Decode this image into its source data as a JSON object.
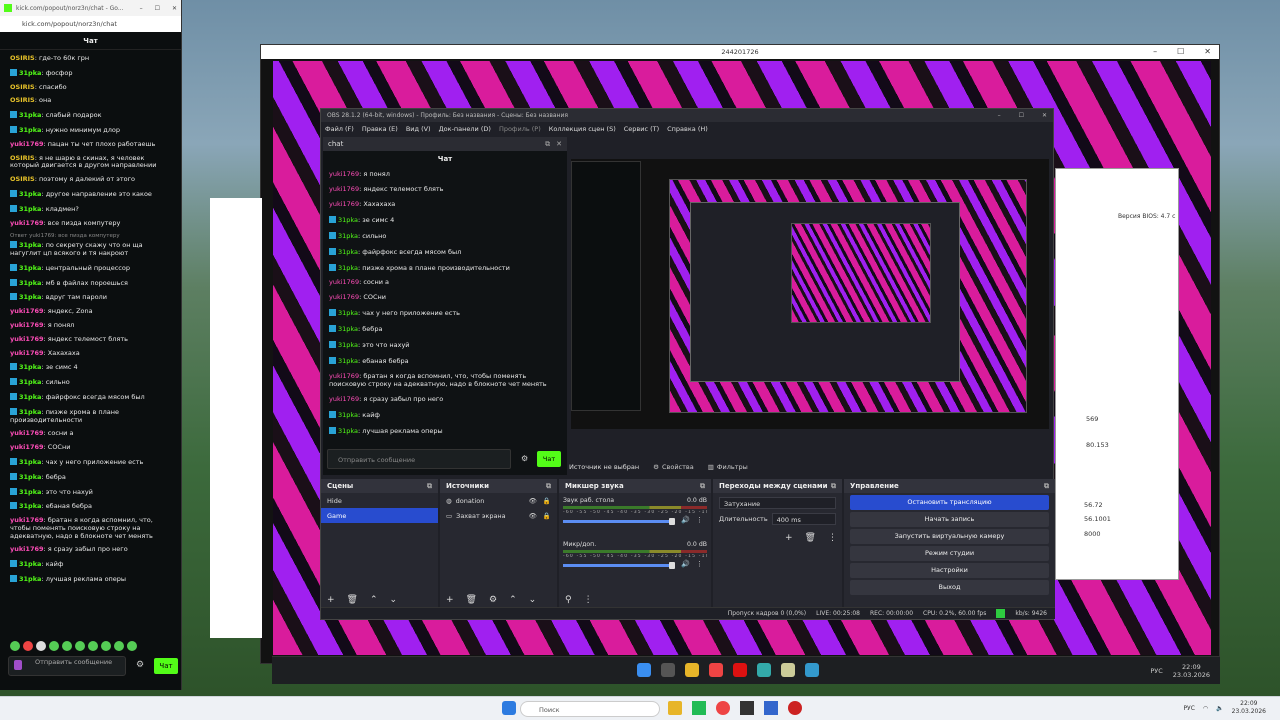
{
  "kick": {
    "tab_title": "kick.com/popout/norz3n/chat - Go...",
    "url": "kick.com/popout/norz3n/chat",
    "header": "Чат",
    "messages": [
      {
        "user": "OSIRIS",
        "color": "#e7c229",
        "badge": false,
        "text": "где-то 60к грн"
      },
      {
        "user": "31pka",
        "color": "#53fc18",
        "badge": true,
        "text": "фосфор"
      },
      {
        "user": "OSIRIS",
        "color": "#e7c229",
        "badge": false,
        "text": "спасибо"
      },
      {
        "user": "OSIRIS",
        "color": "#e7c229",
        "badge": false,
        "text": "она"
      },
      {
        "user": "31pka",
        "color": "#53fc18",
        "badge": true,
        "text": "слабый подарок"
      },
      {
        "user": "31pka",
        "color": "#53fc18",
        "badge": true,
        "text": "нужно минимум длор"
      },
      {
        "user": "yuki1769",
        "color": "#ff4db8",
        "badge": false,
        "text": "пацан ты чет плохо работаешь"
      },
      {
        "user": "OSIRIS",
        "color": "#e7c229",
        "badge": false,
        "text": "я не шарю в скинах, я человек который двигается в другом направлении"
      },
      {
        "user": "OSIRIS",
        "color": "#e7c229",
        "badge": false,
        "text": "поэтому я далекий от этого"
      },
      {
        "user": "31pka",
        "color": "#53fc18",
        "badge": true,
        "text": "другое направление это какое"
      },
      {
        "user": "31pka",
        "color": "#53fc18",
        "badge": true,
        "text": "кладмен?"
      },
      {
        "user": "yuki1769",
        "color": "#ff4db8",
        "badge": false,
        "text": "все пизда компутеру"
      },
      {
        "user": "31pka",
        "color": "#53fc18",
        "badge": true,
        "reply": "Ответ yuki1769: все пизда компутеру",
        "text": "по секрету скажу что он ща нагуглит цп всякого и тя накроют"
      },
      {
        "user": "31pka",
        "color": "#53fc18",
        "badge": true,
        "text": "центральный процессор"
      },
      {
        "user": "31pka",
        "color": "#53fc18",
        "badge": true,
        "text": "мб в файлах пороешься"
      },
      {
        "user": "31pka",
        "color": "#53fc18",
        "badge": true,
        "text": "вдруг там пароли"
      },
      {
        "user": "yuki1769",
        "color": "#ff4db8",
        "badge": false,
        "text": "яндекс, Zona"
      },
      {
        "user": "yuki1769",
        "color": "#ff4db8",
        "badge": false,
        "text": "я понял"
      },
      {
        "user": "yuki1769",
        "color": "#ff4db8",
        "badge": false,
        "text": "яндекс телемост блять"
      },
      {
        "user": "yuki1769",
        "color": "#ff4db8",
        "badge": false,
        "text": "Хахахаха"
      },
      {
        "user": "31pka",
        "color": "#53fc18",
        "badge": true,
        "text": "зе симс 4"
      },
      {
        "user": "31pka",
        "color": "#53fc18",
        "badge": true,
        "text": "сильно"
      },
      {
        "user": "31pka",
        "color": "#53fc18",
        "badge": true,
        "text": "файрфокс всегда мясом был"
      },
      {
        "user": "31pka",
        "color": "#53fc18",
        "badge": true,
        "text": "пизже хрома в плане производительности"
      },
      {
        "user": "yuki1769",
        "color": "#ff4db8",
        "badge": false,
        "text": "сосни а"
      },
      {
        "user": "yuki1769",
        "color": "#ff4db8",
        "badge": false,
        "text": "СОСни"
      },
      {
        "user": "31pka",
        "color": "#53fc18",
        "badge": true,
        "text": "чах у него приложение есть"
      },
      {
        "user": "31pka",
        "color": "#53fc18",
        "badge": true,
        "text": "бебра"
      },
      {
        "user": "31pka",
        "color": "#53fc18",
        "badge": true,
        "text": "это что нахуй"
      },
      {
        "user": "31pka",
        "color": "#53fc18",
        "badge": true,
        "text": "ебаная бебра"
      },
      {
        "user": "yuki1769",
        "color": "#ff4db8",
        "badge": false,
        "text": "братан я когда вспомнил, что, чтобы поменять поисковую строку на адекватную, надо в блокноте чет менять"
      },
      {
        "user": "yuki1769",
        "color": "#ff4db8",
        "badge": false,
        "text": "я сразу забыл про него"
      },
      {
        "user": "31pka",
        "color": "#53fc18",
        "badge": true,
        "text": "кайф"
      },
      {
        "user": "31pka",
        "color": "#53fc18",
        "badge": true,
        "text": "лучшая реклама оперы"
      }
    ],
    "input_placeholder": "Отправить сообщение",
    "send_label": "Чат"
  },
  "viewer": {
    "title": "244201726"
  },
  "obs": {
    "title": "OBS 28.1.2 (64-bit, windows) - Профиль: Без названия - Сцены: Без названия",
    "menu": [
      "Файл (F)",
      "Правка (E)",
      "Вид (V)",
      "Док-панели (D)",
      "Профиль (P)",
      "Коллекция сцен (S)",
      "Сервис (T)",
      "Справка (H)"
    ],
    "chat_dock_title": "chat",
    "chat_header": "Чат",
    "dock_messages": [
      {
        "user": "yuki1769",
        "color": "#ff4db8",
        "badge": false,
        "text": "я понял"
      },
      {
        "user": "yuki1769",
        "color": "#ff4db8",
        "badge": false,
        "text": "яндекс телемост блять"
      },
      {
        "user": "yuki1769",
        "color": "#ff4db8",
        "badge": false,
        "text": "Хахахаха"
      },
      {
        "user": "31pka",
        "color": "#53fc18",
        "badge": true,
        "text": "зе симс 4"
      },
      {
        "user": "31pka",
        "color": "#53fc18",
        "badge": true,
        "text": "сильно"
      },
      {
        "user": "31pka",
        "color": "#53fc18",
        "badge": true,
        "text": "файрфокс всегда мясом был"
      },
      {
        "user": "31pka",
        "color": "#53fc18",
        "badge": true,
        "text": "пизже хрома в плане производительности"
      },
      {
        "user": "yuki1769",
        "color": "#ff4db8",
        "badge": false,
        "text": "сосни а"
      },
      {
        "user": "yuki1769",
        "color": "#ff4db8",
        "badge": false,
        "text": "СОСни"
      },
      {
        "user": "31pka",
        "color": "#53fc18",
        "badge": true,
        "text": "чах у него приложение есть"
      },
      {
        "user": "31pka",
        "color": "#53fc18",
        "badge": true,
        "text": "бебра"
      },
      {
        "user": "31pka",
        "color": "#53fc18",
        "badge": true,
        "text": "это что нахуй"
      },
      {
        "user": "31pka",
        "color": "#53fc18",
        "badge": true,
        "text": "ебаная бебра"
      },
      {
        "user": "yuki1769",
        "color": "#ff4db8",
        "badge": false,
        "text": "братан я когда вспомнил, что, чтобы поменять поисковую строку на адекватную, надо в блокноте чет менять"
      },
      {
        "user": "yuki1769",
        "color": "#ff4db8",
        "badge": false,
        "text": "я сразу забыл про него"
      },
      {
        "user": "31pka",
        "color": "#53fc18",
        "badge": true,
        "text": "кайф"
      },
      {
        "user": "31pka",
        "color": "#53fc18",
        "badge": true,
        "text": "лучшая реклама оперы"
      }
    ],
    "input_placeholder": "Отправить сообщение",
    "send_label": "Чат",
    "source_status": "Источник не выбран",
    "properties_label": "Свойства",
    "filters_label": "Фильтры",
    "scenes": {
      "title": "Сцены",
      "items": [
        "Hide",
        "Game"
      ],
      "selected": 1
    },
    "sources": {
      "title": "Источники",
      "items": [
        "donation",
        "Захват экрана"
      ]
    },
    "mixer": {
      "title": "Микшер звука",
      "channels": [
        {
          "name": "Звук раб. стола",
          "db": "0.0 dB"
        },
        {
          "name": "Микр/доп.",
          "db": "0.0 dB"
        }
      ],
      "ticks": "-60 -55 -50 -45 -40 -35 -30 -25 -20 -15 -10 -5 0"
    },
    "transitions": {
      "title": "Переходы между сценами",
      "type": "Затухание",
      "duration_label": "Длительность",
      "duration": "400 ms"
    },
    "controls": {
      "title": "Управление",
      "buttons": [
        "Остановить трансляцию",
        "Начать запись",
        "Запустить виртуальную камеру",
        "Режим студии",
        "Настройки",
        "Выход"
      ]
    },
    "status": {
      "dropped": "Пропуск кадров 0 (0,0%)",
      "live": "LIVE: 00:25:08",
      "rec": "REC: 00:00:00",
      "cpu": "CPU: 0.2%, 60.00 fps",
      "kbps": "kb/s: 9426"
    }
  },
  "screen_taskbar": {
    "lang": "РУС",
    "time": "22:09",
    "date": "23.03.2026"
  },
  "taskbar": {
    "search": "Поиск",
    "lang": "РУС",
    "time": "22:09",
    "date": "23.03.2026"
  },
  "bg": {
    "bios": "Версия BIOS: 4.7 с",
    "n1": "569",
    "n2": "80.153",
    "n3": "56.72",
    "n4": "56.1001",
    "n5": "8000"
  }
}
